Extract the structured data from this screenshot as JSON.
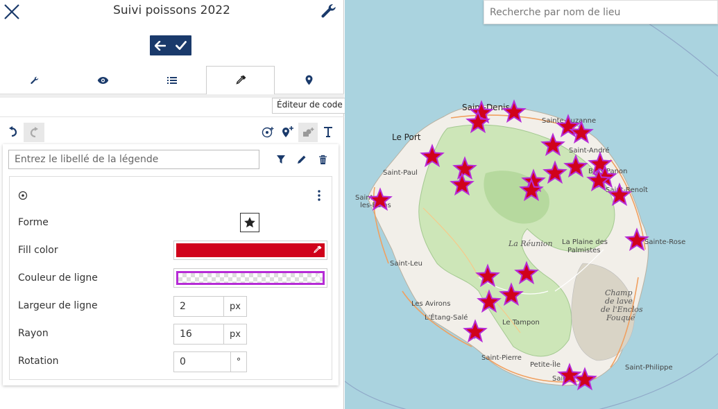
{
  "header": {
    "title": "Suivi poissons 2022"
  },
  "tabs": [
    {
      "name": "tab-settings",
      "icon": "wrench-icon"
    },
    {
      "name": "tab-view",
      "icon": "eye-icon"
    },
    {
      "name": "tab-list",
      "icon": "list-icon"
    },
    {
      "name": "tab-style",
      "icon": "eyedropper-icon",
      "active": true
    },
    {
      "name": "tab-location",
      "icon": "map-marker-icon"
    }
  ],
  "tooltip": {
    "text": "Éditeur de code"
  },
  "legend": {
    "placeholder": "Entrez le libellé de la légende"
  },
  "style": {
    "shape_label": "Forme",
    "fill_label": "Fill color",
    "fill_color": "#d0021b",
    "line_color_label": "Couleur de ligne",
    "line_color": "#b62bd6",
    "line_width_label": "Largeur de ligne",
    "line_width": "2",
    "line_width_unit": "px",
    "radius_label": "Rayon",
    "radius": "16",
    "radius_unit": "px",
    "rotation_label": "Rotation",
    "rotation": "0",
    "rotation_unit": "°"
  },
  "map": {
    "search_placeholder": "Recherche par nom de lieu",
    "marker_color": "#d0021b",
    "marker_stroke": "#b62bd6",
    "labels": {
      "saint_denis": "Saint-Denis",
      "le_port": "Le Port",
      "sainte_suzanne": "Sainte-Suzanne",
      "saint_andre": "Saint-André",
      "bras_panon": "Bras-Panon",
      "saint_benoit": "Saint-Benoît",
      "saint_paul": "Saint-Paul",
      "saint_gilles_1": "Saint-",
      "saint_gilles_2": "les-Bains",
      "la_reunion": "La Réunion",
      "plaine_1": "La Plaine des",
      "plaine_2": "Palmistes",
      "sainte_rose": "Sainte-Rose",
      "saint_leu": "Saint-Leu",
      "avirons": "Les Avirons",
      "etang_sale": "L'Étang-Salé",
      "le_tampon": "Le Tampon",
      "saint_pierre": "Saint-Pierre",
      "petite_ile": "Petite-Île",
      "saint_joseph": "Saint",
      "saint_philippe": "Saint-Philippe",
      "enclos_1": "Champ",
      "enclos_2": "de lave",
      "enclos_3": "de l'Enclos",
      "enclos_4": "Fouqué"
    }
  }
}
